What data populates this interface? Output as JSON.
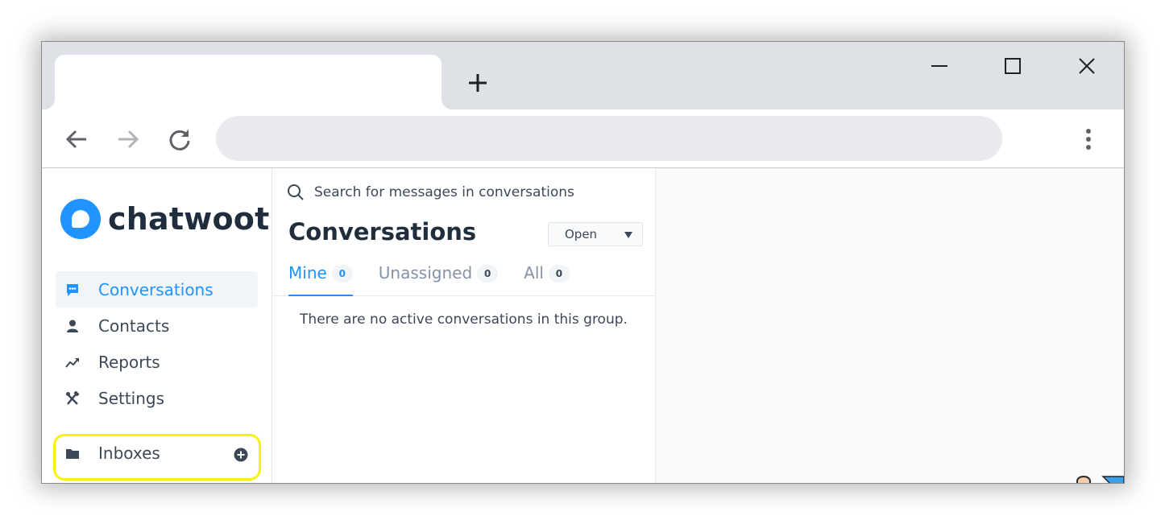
{
  "browser": {
    "tab_title": "",
    "address": ""
  },
  "sidebar": {
    "brand": "chatwoot",
    "items": [
      {
        "label": "Conversations",
        "icon": "chat-bubble-icon",
        "active": true
      },
      {
        "label": "Contacts",
        "icon": "person-icon",
        "active": false
      },
      {
        "label": "Reports",
        "icon": "trend-icon",
        "active": false
      },
      {
        "label": "Settings",
        "icon": "tools-icon",
        "active": false
      }
    ],
    "inboxes_label": "Inboxes"
  },
  "conversations": {
    "search_placeholder": "Search for messages in conversations",
    "title": "Conversations",
    "status": "Open",
    "tabs": [
      {
        "label": "Mine",
        "count": "0",
        "active": true
      },
      {
        "label": "Unassigned",
        "count": "0",
        "active": false
      },
      {
        "label": "All",
        "count": "0",
        "active": false
      }
    ],
    "empty_message": "There are no active conversations in this group."
  },
  "colors": {
    "accent": "#1f93ff",
    "text": "#3c4858",
    "highlight": "#f8f20b"
  }
}
